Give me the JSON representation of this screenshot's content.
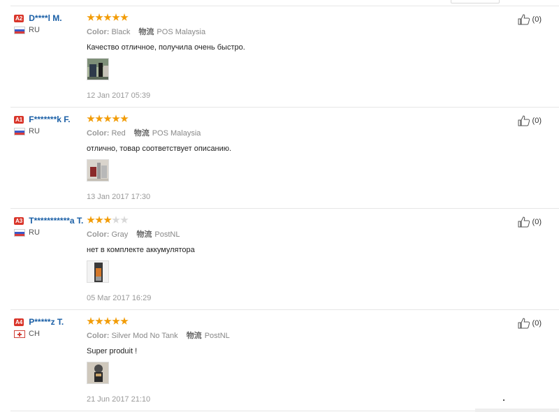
{
  "reviews": [
    {
      "rank": "A2",
      "name": "D****l M.",
      "country": "RU",
      "flag": "ru",
      "rating": 5,
      "color_label": "Color:",
      "color_value": "Black",
      "logistics_label": "物流",
      "logistics_value": "POS Malaysia",
      "text": "Качество отличное, получила очень быстро.",
      "photo_icon": "product-photo",
      "date": "12 Jan 2017 05:39",
      "helpful": "(0)"
    },
    {
      "rank": "A1",
      "name": "F*******k F.",
      "country": "RU",
      "flag": "ru",
      "rating": 5,
      "color_label": "Color:",
      "color_value": "Red",
      "logistics_label": "物流",
      "logistics_value": "POS Malaysia",
      "text": "отлично, товар соответствует описанию.",
      "photo_icon": "product-photo",
      "date": "13 Jan 2017 17:30",
      "helpful": "(0)"
    },
    {
      "rank": "A3",
      "name": "T***********a T.",
      "country": "RU",
      "flag": "ru",
      "rating": 3,
      "color_label": "Color:",
      "color_value": "Gray",
      "logistics_label": "物流",
      "logistics_value": "PostNL",
      "text": "нет в комплекте аккумулятора",
      "photo_icon": "product-photo",
      "date": "05 Mar 2017 16:29",
      "helpful": "(0)"
    },
    {
      "rank": "A4",
      "name": "P*****z T.",
      "country": "CH",
      "flag": "ch",
      "rating": 5,
      "color_label": "Color:",
      "color_value": "Silver Mod No Tank",
      "logistics_label": "物流",
      "logistics_value": "PostNL",
      "text": "Super produit !",
      "photo_icon": "product-photo",
      "date": "21 Jun 2017 21:10",
      "helpful": "(0)"
    }
  ],
  "colors": {
    "star_on": "#f29c07",
    "star_off": "#d8d8d8",
    "name": "#1a5fa6",
    "rank_badge": "#d9352a"
  }
}
